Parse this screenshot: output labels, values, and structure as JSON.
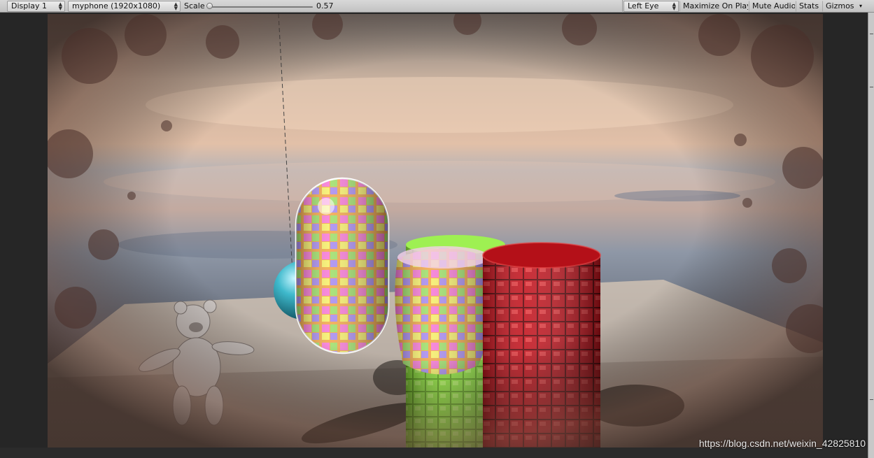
{
  "toolbar": {
    "display": "Display 1",
    "resolution": "myphone (1920x1080)",
    "scale_label": "Scale",
    "scale_value": "0.57",
    "scale_fraction": 0.0,
    "eye": "Left Eye",
    "maximize": "Maximize On Play",
    "mute": "Mute Audio",
    "stats": "Stats",
    "gizmos": "Gizmos"
  },
  "watermark": "https://blog.csdn.net/weixin_42825810",
  "colors": {
    "toolbar_bg": "#d0d0d0",
    "view_bg": "#262626",
    "capsule_tile": "#ff9ad8",
    "green_cylinder": "#7ee62a",
    "red_cylinder": "#c8101a",
    "teal_sphere": "#3bb6c8"
  },
  "icons": [
    "dropdown-arrows-icon",
    "slider-thumb-icon"
  ]
}
